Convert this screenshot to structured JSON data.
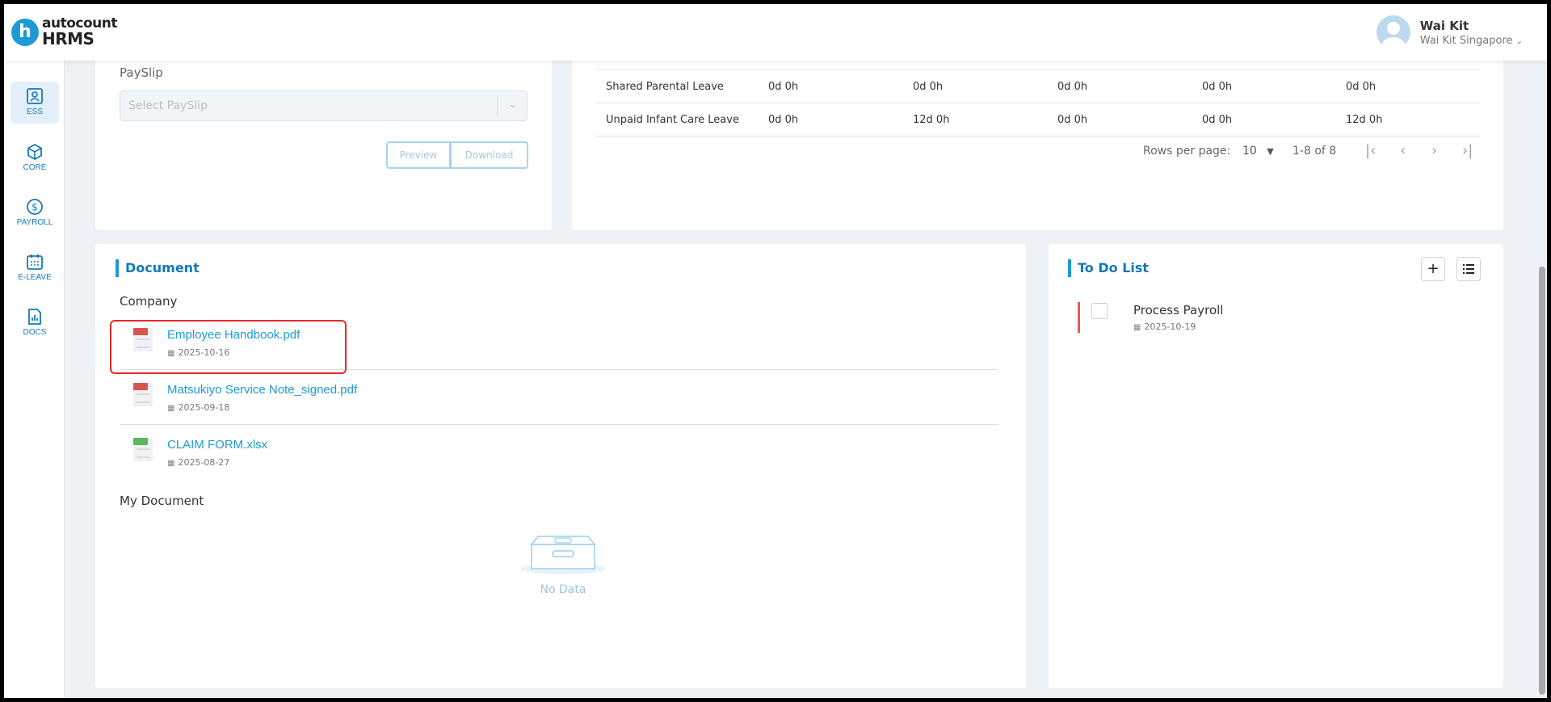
{
  "header": {
    "logo_line1": "autocount",
    "logo_line2": "HRMS",
    "logo_badge": "h",
    "user_name": "Wai Kit",
    "user_company": "Wai Kit Singapore"
  },
  "sidebar": {
    "items": [
      {
        "label": "ESS",
        "icon": "ess-icon",
        "active": true
      },
      {
        "label": "CORE",
        "icon": "core-icon",
        "active": false
      },
      {
        "label": "PAYROLL",
        "icon": "payroll-icon",
        "active": false
      },
      {
        "label": "E-LEAVE",
        "icon": "calendar-icon",
        "active": false
      },
      {
        "label": "DOCS",
        "icon": "docs-icon",
        "active": false
      }
    ]
  },
  "payslip": {
    "label": "PaySlip",
    "placeholder": "Select PaySlip",
    "preview_label": "Preview",
    "download_label": "Download"
  },
  "leave_table": {
    "rows": [
      {
        "name": "Shared Parental Leave",
        "c1": "0d 0h",
        "c2": "0d 0h",
        "c3": "0d 0h",
        "c4": "0d 0h",
        "c5": "0d 0h"
      },
      {
        "name": "Unpaid Infant Care Leave",
        "c1": "0d 0h",
        "c2": "12d 0h",
        "c3": "0d 0h",
        "c4": "0d 0h",
        "c5": "12d 0h"
      }
    ],
    "rows_per_page_label": "Rows per page:",
    "rows_per_page_value": "10",
    "range_text": "1-8 of 8"
  },
  "document": {
    "title": "Document",
    "company_label": "Company",
    "company_docs": [
      {
        "name": "Employee Handbook.pdf",
        "date": "2025-10-16",
        "type": "pdf"
      },
      {
        "name": "Matsukiyo Service Note_signed.pdf",
        "date": "2025-09-18",
        "type": "pdf"
      },
      {
        "name": "CLAIM FORM.xlsx",
        "date": "2025-08-27",
        "type": "xlsx"
      }
    ],
    "my_document_label": "My Document",
    "no_data_text": "No Data"
  },
  "todo": {
    "title": "To Do List",
    "add_symbol": "+",
    "items": [
      {
        "title": "Process Payroll",
        "date": "2025-10-19"
      }
    ]
  },
  "colors": {
    "accent": "#1d9ad6",
    "title_blue": "#1479b8",
    "highlight_red": "#e32b2b",
    "pdf_red": "#d9534f",
    "xlsx_green": "#5cb85c"
  }
}
